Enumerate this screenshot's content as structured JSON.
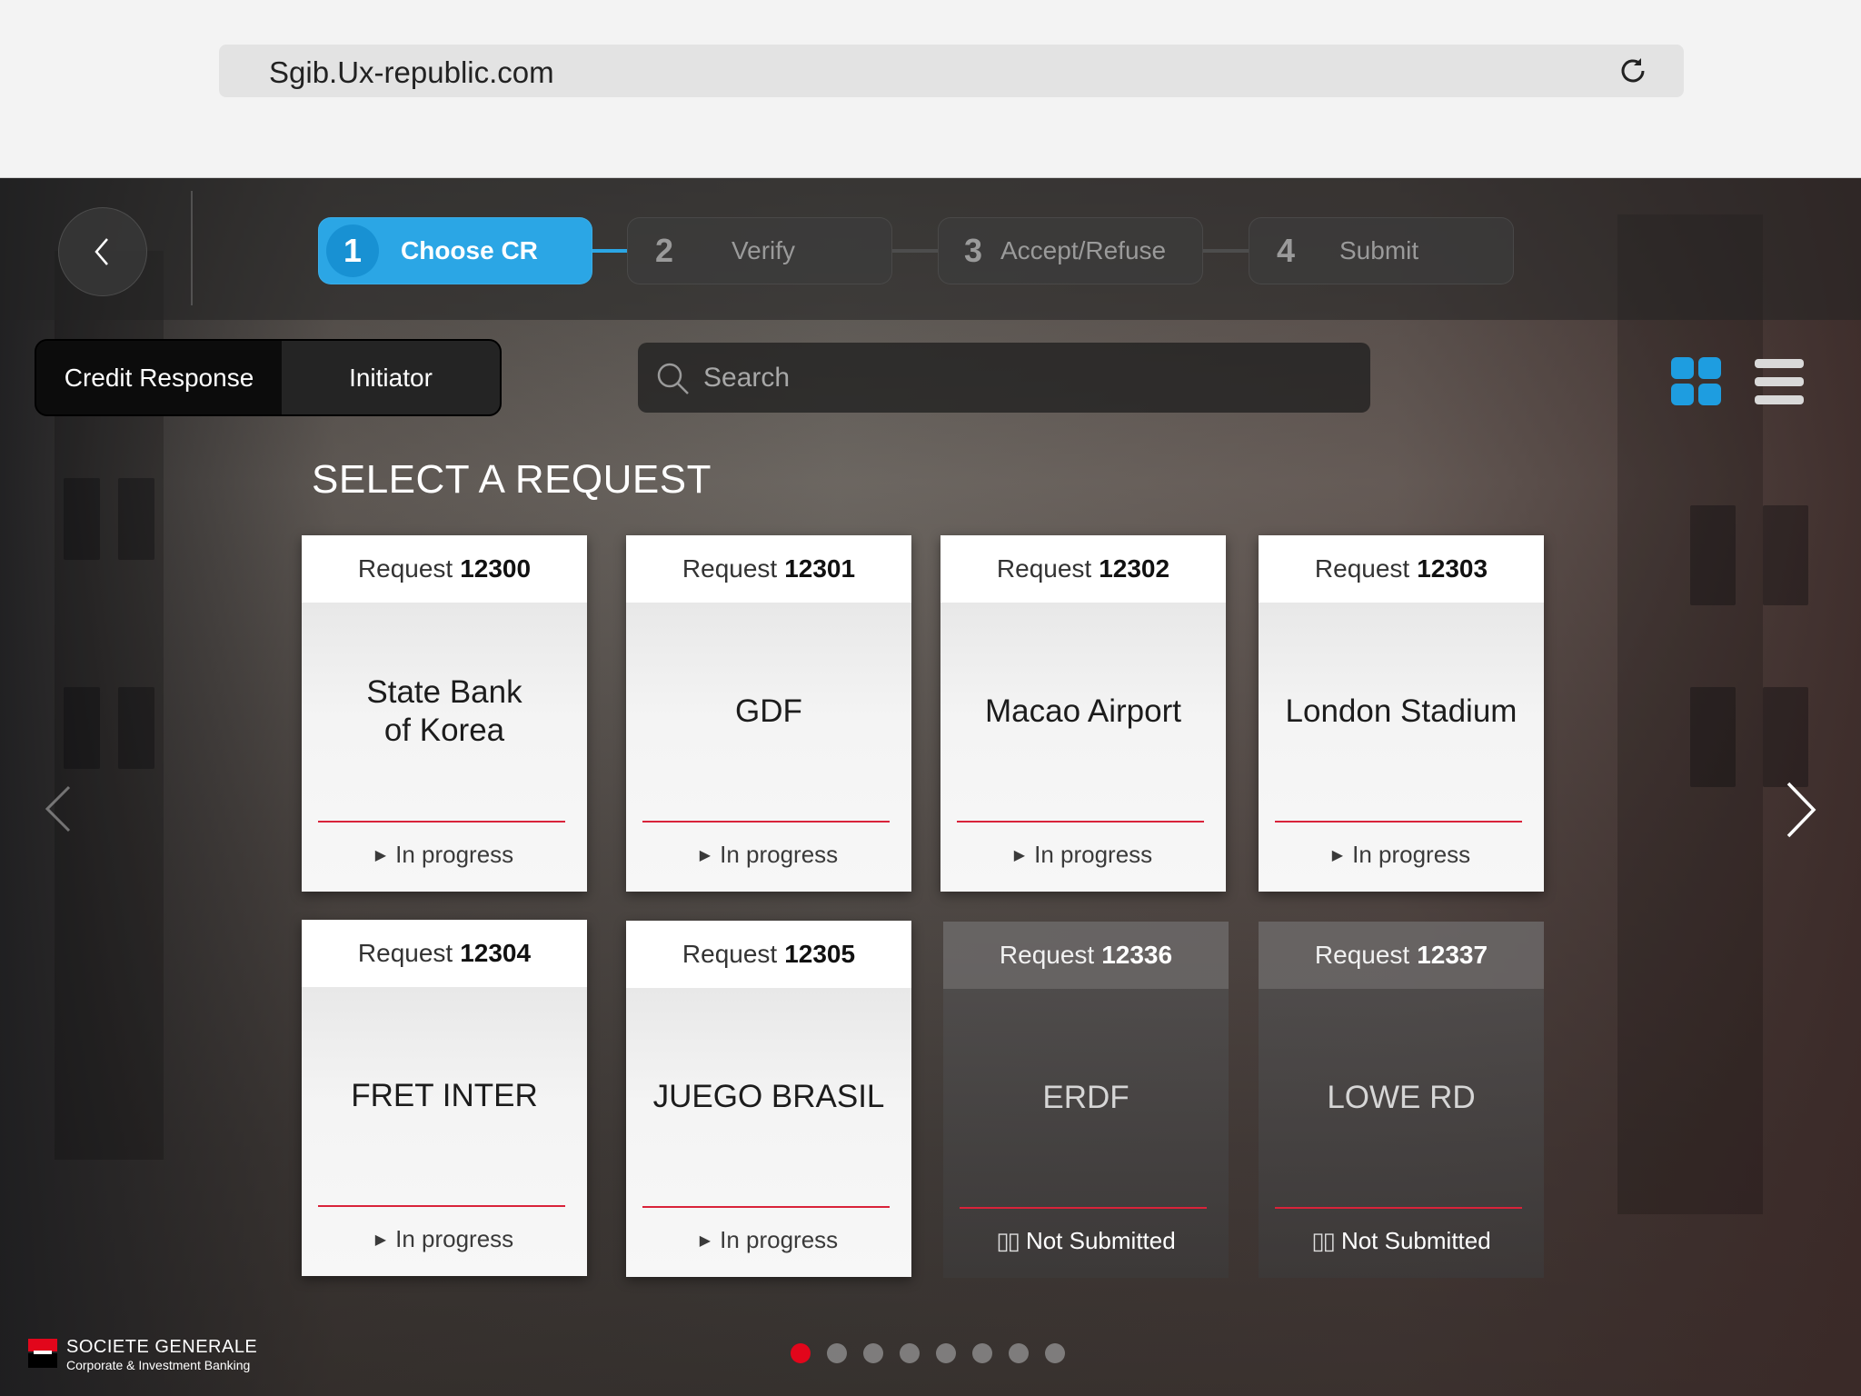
{
  "browser": {
    "url": "Sgib.Ux-republic.com"
  },
  "nav": {
    "steps": [
      {
        "number": "1",
        "label": "Choose CR",
        "active": true
      },
      {
        "number": "2",
        "label": "Verify",
        "active": false
      },
      {
        "number": "3",
        "label": "Accept/Refuse",
        "active": false
      },
      {
        "number": "4",
        "label": "Submit",
        "active": false
      }
    ]
  },
  "filter": {
    "segments": [
      "Credit Response",
      "Initiator"
    ],
    "selected": "Credit Response"
  },
  "search": {
    "placeholder": "Search"
  },
  "view_toggle": {
    "grid_icon": "grid-icon",
    "list_icon": "list-icon",
    "active": "grid",
    "accent_color": "#2ba6e5"
  },
  "page": {
    "title": "SELECT A REQUEST"
  },
  "cards": [
    {
      "prefix": "Request",
      "number": "12300",
      "name": "State Bank\nof Korea",
      "status": "In progress",
      "state": "in-progress"
    },
    {
      "prefix": "Request",
      "number": "12301",
      "name": "GDF",
      "status": "In progress",
      "state": "in-progress"
    },
    {
      "prefix": "Request",
      "number": "12302",
      "name": "Macao Airport",
      "status": "In progress",
      "state": "in-progress"
    },
    {
      "prefix": "Request",
      "number": "12303",
      "name": "London Stadium",
      "status": "In progress",
      "state": "in-progress"
    },
    {
      "prefix": "Request",
      "number": "12304",
      "name": "FRET INTER",
      "status": "In progress",
      "state": "in-progress"
    },
    {
      "prefix": "Request",
      "number": "12305",
      "name": "JUEGO BRASIL",
      "status": "In progress",
      "state": "in-progress"
    },
    {
      "prefix": "Request",
      "number": "12336",
      "name": "ERDF",
      "status": "Not Submitted",
      "state": "not-submitted"
    },
    {
      "prefix": "Request",
      "number": "12337",
      "name": "LOWE RD",
      "status": "Not Submitted",
      "state": "not-submitted"
    }
  ],
  "pagination": {
    "pages": 8,
    "current": 1,
    "active_color": "#e2061b"
  },
  "brand": {
    "name": "SOCIETE GENERALE",
    "subtitle": "Corporate & Investment Banking"
  }
}
